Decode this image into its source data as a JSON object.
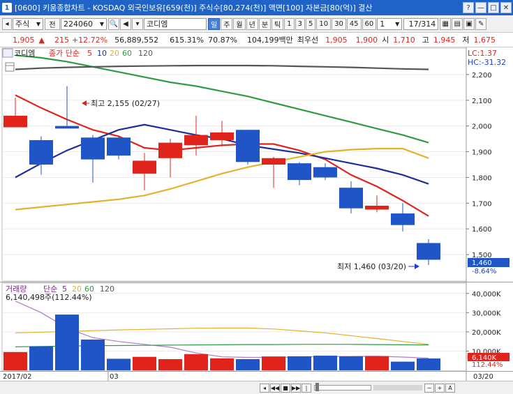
{
  "title_bar": {
    "window_number": "1",
    "title": "[0600] 키움종합차트 - KOSDAQ 외국인보유[659(천)] 주식수[80,274(천)] 액면[100] 자본금[80(억)] 결산",
    "buttons": [
      "?",
      "—",
      "□",
      "✕"
    ]
  },
  "toolbar": {
    "market": "주식",
    "view_label": "전",
    "stock_code": "224060",
    "stock_name": "코디엠",
    "periods": [
      "일",
      "주",
      "월",
      "년",
      "분",
      "틱",
      "1",
      "3",
      "5",
      "10",
      "30",
      "45",
      "60"
    ],
    "selected_period": "일",
    "interval_value": "1",
    "page_counter": "17/314"
  },
  "quote": {
    "price": "1,905",
    "change_arrow": "▲",
    "change": "215",
    "change_pct": "+12.72%",
    "volume": "56,889,552",
    "volume_ratio": "615.31%",
    "turnover": "70.87%",
    "amount": "104,199백만",
    "bid_label": "최우선",
    "ask_price": "1,905",
    "bid_price": "1,900",
    "open_label": "시",
    "open": "1,710",
    "high_label": "고",
    "high": "1,945",
    "low_label": "저",
    "low": "1,675"
  },
  "price_panel": {
    "stock_name": "코디엠",
    "series_label": "종가 단순",
    "ma_periods": [
      "5",
      "10",
      "20",
      "60",
      "120"
    ],
    "lc_label": "LC:1.37",
    "hc_label": "HC:-31.32",
    "high_annotation": "최고 2,155 (02/27)",
    "low_annotation": "최저 1,460 (03/20)",
    "current_price_tag": "1,460",
    "current_change_tag": "-8.64%"
  },
  "volume_panel": {
    "title": "거래량",
    "series_label": "단순",
    "ma_periods": [
      "5",
      "20",
      "60",
      "120"
    ],
    "value_label": "6,140,498주(112.44%)",
    "current_volume_tag": "6,140K",
    "current_pct_tag": "112.44%"
  },
  "x_axis": {
    "labels": [
      "2017/02",
      "03"
    ],
    "right_label": "03/20"
  },
  "colors": {
    "up": "#e0241c",
    "down": "#1f55c6",
    "ma5": "#e0241c",
    "ma10": "#1b2f9b",
    "ma20": "#e3b22a",
    "ma60": "#2e9a45",
    "ma120": "#555555",
    "titlebar": "#1f63c6"
  },
  "chart_data": [
    {
      "type": "candlestick",
      "name": "price",
      "ylim": [
        1400,
        2300
      ],
      "y_ticks": [
        1500,
        1600,
        1700,
        1800,
        1900,
        2000,
        2100,
        2200
      ],
      "candles": [
        {
          "o": 1995,
          "h": 2110,
          "l": 1995,
          "c": 2040
        },
        {
          "o": 1945,
          "h": 1960,
          "l": 1810,
          "c": 1850
        },
        {
          "o": 2000,
          "h": 2155,
          "l": 1995,
          "c": 1990
        },
        {
          "o": 1955,
          "h": 1965,
          "l": 1780,
          "c": 1870
        },
        {
          "o": 1955,
          "h": 1960,
          "l": 1870,
          "c": 1885
        },
        {
          "o": 1815,
          "h": 1895,
          "l": 1750,
          "c": 1865
        },
        {
          "o": 1875,
          "h": 1950,
          "l": 1800,
          "c": 1935
        },
        {
          "o": 1925,
          "h": 2040,
          "l": 1885,
          "c": 1965
        },
        {
          "o": 1945,
          "h": 2020,
          "l": 1920,
          "c": 1975
        },
        {
          "o": 1985,
          "h": 1985,
          "l": 1850,
          "c": 1860
        },
        {
          "o": 1850,
          "h": 1880,
          "l": 1760,
          "c": 1875
        },
        {
          "o": 1855,
          "h": 1860,
          "l": 1770,
          "c": 1790
        },
        {
          "o": 1840,
          "h": 1855,
          "l": 1790,
          "c": 1800
        },
        {
          "o": 1760,
          "h": 1785,
          "l": 1660,
          "c": 1680
        },
        {
          "o": 1675,
          "h": 1730,
          "l": 1665,
          "c": 1690
        },
        {
          "o": 1660,
          "h": 1700,
          "l": 1590,
          "c": 1615
        },
        {
          "o": 1545,
          "h": 1560,
          "l": 1460,
          "c": 1480
        }
      ],
      "ma_lines": [
        {
          "name": "5",
          "values": [
            2120,
            2070,
            2025,
            1985,
            1960,
            1915,
            1905,
            1915,
            1925,
            1930,
            1930,
            1905,
            1870,
            1810,
            1765,
            1710,
            1650
          ]
        },
        {
          "name": "10",
          "values": [
            1800,
            1855,
            1905,
            1945,
            1985,
            2005,
            1985,
            1965,
            1950,
            1925,
            1910,
            1895,
            1875,
            1855,
            1835,
            1810,
            1775
          ]
        },
        {
          "name": "20",
          "values": [
            1675,
            1685,
            1695,
            1705,
            1715,
            1730,
            1755,
            1785,
            1815,
            1840,
            1860,
            1880,
            1900,
            1908,
            1912,
            1912,
            1875
          ]
        },
        {
          "name": "60",
          "values": [
            2275,
            2265,
            2250,
            2230,
            2210,
            2190,
            2170,
            2155,
            2135,
            2115,
            2090,
            2065,
            2040,
            2015,
            1990,
            1965,
            1935
          ]
        },
        {
          "name": "120",
          "values": [
            2220,
            2225,
            2228,
            2230,
            2232,
            2233,
            2234,
            2235,
            2235,
            2235,
            2234,
            2232,
            2230,
            2228,
            2225,
            2222,
            2220
          ]
        }
      ]
    },
    {
      "type": "bar",
      "name": "volume",
      "ylim": [
        0,
        45000
      ],
      "y_ticks": [
        10000,
        20000,
        30000,
        40000
      ],
      "y_tick_labels": [
        "10,000K",
        "20,000K",
        "30,000K",
        "40,000K"
      ],
      "values": [
        9500,
        12500,
        29000,
        16000,
        6000,
        7000,
        5800,
        8400,
        6200,
        5800,
        7200,
        7300,
        7600,
        7300,
        7400,
        4500,
        6140
      ],
      "ma_lines": [
        {
          "name": "5",
          "values": [
            36000,
            30000,
            22000,
            17000,
            15000,
            13500,
            12000,
            9000,
            7000,
            6700,
            6700,
            6900,
            7100,
            7200,
            7300,
            6900,
            6300
          ]
        },
        {
          "name": "20",
          "values": [
            19500,
            19800,
            20200,
            20600,
            21000,
            21300,
            21600,
            21900,
            22000,
            22000,
            21500,
            20500,
            19500,
            18000,
            16500,
            15000,
            13500
          ]
        },
        {
          "name": "60",
          "values": [
            12200,
            12400,
            12600,
            12800,
            12900,
            13000,
            13100,
            13200,
            13300,
            13400,
            13400,
            13500,
            13500,
            13500,
            13400,
            13300,
            13200
          ]
        }
      ]
    }
  ]
}
